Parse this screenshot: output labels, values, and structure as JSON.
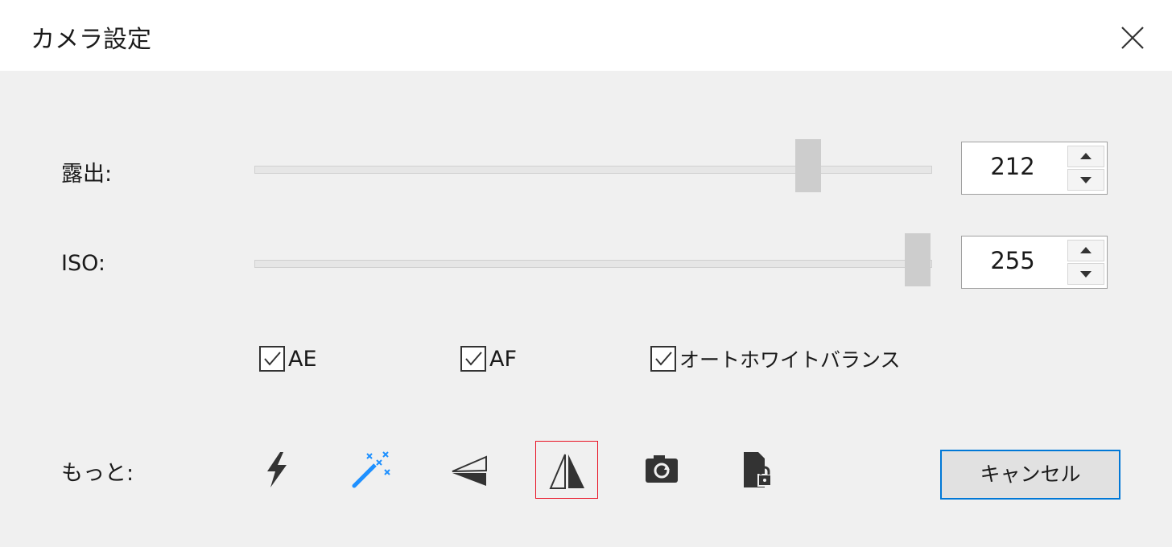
{
  "dialog": {
    "title": "カメラ設定"
  },
  "exposure": {
    "label": "露出:",
    "value": "212",
    "level": 212,
    "max": 255
  },
  "iso": {
    "label": "ISO:",
    "value": "255",
    "level": 255,
    "max": 255
  },
  "options": [
    {
      "label": "AE",
      "checked": true
    },
    {
      "label": "AF",
      "checked": true
    },
    {
      "label": "オートホワイトバランス",
      "checked": true
    }
  ],
  "more": {
    "label": "もっと:",
    "tools": [
      {
        "icon": "flash-icon",
        "color": "#333333"
      },
      {
        "icon": "magic-wand-icon",
        "color": "#1e90ff"
      },
      {
        "icon": "flip-vertical-icon",
        "color": "#333333"
      },
      {
        "icon": "flip-horizontal-icon",
        "color": "#333333",
        "selected": true
      },
      {
        "icon": "rotate-camera-icon",
        "color": "#333333"
      },
      {
        "icon": "lock-file-icon",
        "color": "#333333"
      }
    ]
  },
  "cancel_label": "キャンセル",
  "colors": {
    "accent": "#0078d7",
    "selection": "#e81123"
  }
}
